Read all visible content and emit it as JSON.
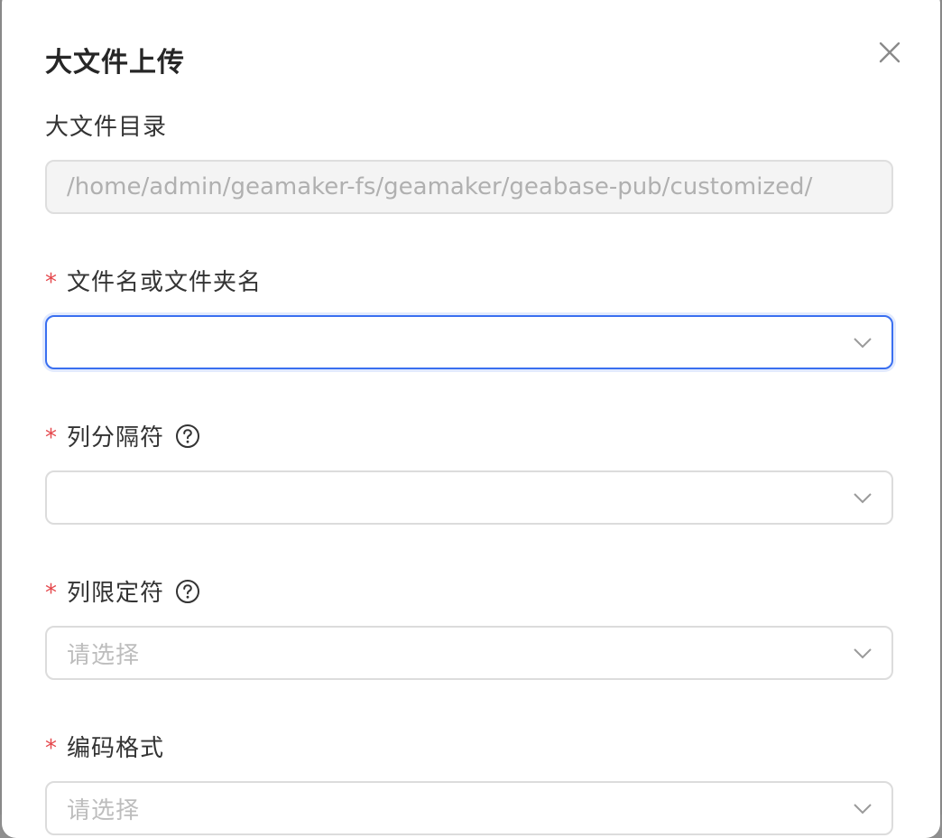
{
  "dialog": {
    "title": "大文件上传"
  },
  "fields": {
    "dir": {
      "label": "大文件目录",
      "value": "/home/admin/geamaker-fs/geamaker/geabase-pub/customized/"
    },
    "filename": {
      "required_mark": "*",
      "label": "文件名或文件夹名",
      "value": ""
    },
    "separator": {
      "required_mark": "*",
      "label": "列分隔符",
      "value": ""
    },
    "qualifier": {
      "required_mark": "*",
      "label": "列限定符",
      "placeholder": "请选择"
    },
    "encoding": {
      "required_mark": "*",
      "label": "编码格式",
      "placeholder": "请选择"
    }
  },
  "icons": {
    "close": "close-icon",
    "help": "question-circle-icon",
    "chevron": "chevron-down-icon"
  },
  "colors": {
    "required": "#e5484d",
    "focus_border": "#3a6ff0"
  }
}
